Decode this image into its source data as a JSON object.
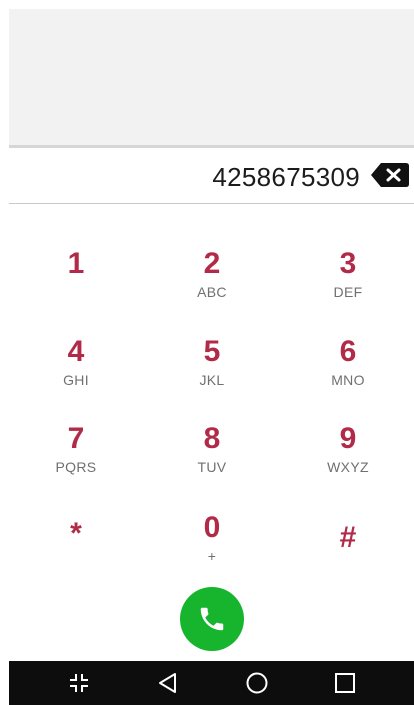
{
  "dialer": {
    "number": "4258675309",
    "keys": [
      {
        "digit": "1",
        "letters": ""
      },
      {
        "digit": "2",
        "letters": "ABC"
      },
      {
        "digit": "3",
        "letters": "DEF"
      },
      {
        "digit": "4",
        "letters": "GHI"
      },
      {
        "digit": "5",
        "letters": "JKL"
      },
      {
        "digit": "6",
        "letters": "MNO"
      },
      {
        "digit": "7",
        "letters": "PQRS"
      },
      {
        "digit": "8",
        "letters": "TUV"
      },
      {
        "digit": "9",
        "letters": "WXYZ"
      },
      {
        "digit": "*",
        "letters": ""
      },
      {
        "digit": "0",
        "letters": "+"
      },
      {
        "digit": "#",
        "letters": ""
      }
    ]
  },
  "icons": {
    "backspace": "backspace-icon",
    "call": "phone-icon",
    "nav": [
      "collapse-icon",
      "back-icon",
      "home-icon",
      "recents-icon"
    ]
  },
  "colors": {
    "digit": "#b12a48",
    "call_button": "#17b42e",
    "navbar": "#0d0d0d"
  }
}
